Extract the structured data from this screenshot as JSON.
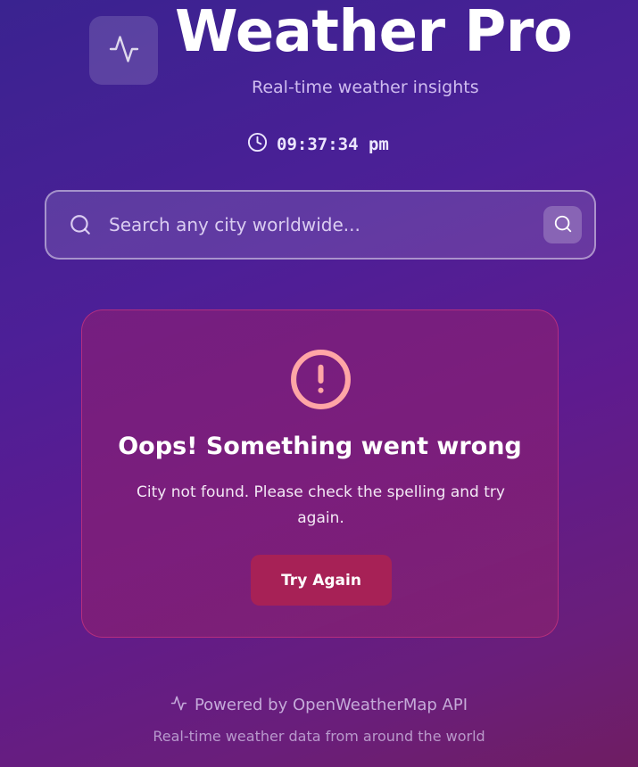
{
  "header": {
    "title": "Weather Pro",
    "subtitle": "Real-time weather insights",
    "logo_icon": "activity-icon"
  },
  "clock": {
    "icon": "clock-icon",
    "time": "09:37:34 pm"
  },
  "search": {
    "placeholder": "Search any city worldwide...",
    "value": "",
    "icon": "search-icon",
    "button_icon": "search-icon"
  },
  "error": {
    "icon": "alert-circle-icon",
    "title": "Oops! Something went wrong",
    "message": "City not found. Please check the spelling and try again.",
    "button_label": "Try Again"
  },
  "footer": {
    "icon": "activity-icon",
    "powered_by": "Powered by OpenWeatherMap API",
    "tagline": "Real-time weather data from around the world"
  },
  "colors": {
    "background_start": "#3a2390",
    "background_end": "#6f1d62",
    "button_accent": "#a72156",
    "alert_icon": "#ffa6a6"
  }
}
